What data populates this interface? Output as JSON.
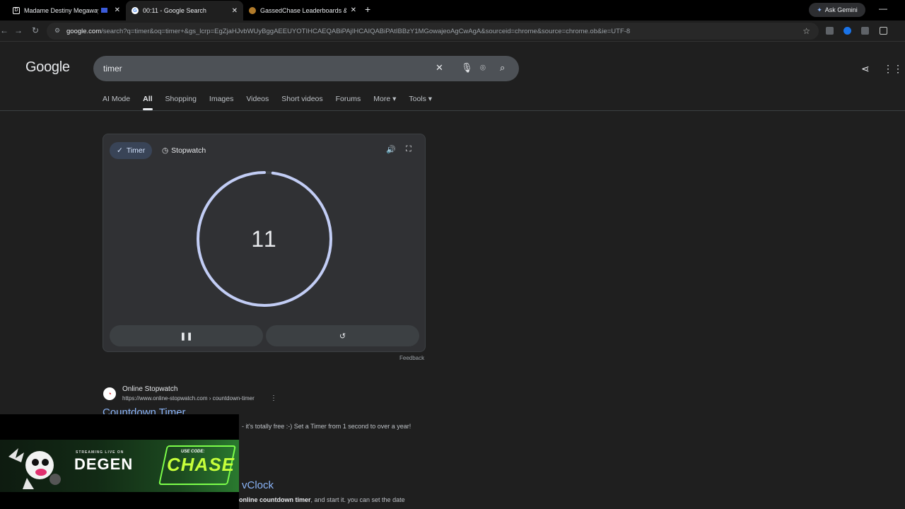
{
  "browser": {
    "tabs": [
      {
        "title": "Madame Destiny Megaways",
        "active": false
      },
      {
        "title": "00:11 - Google Search",
        "active": true
      },
      {
        "title": "GassedChase Leaderboards & B",
        "active": false
      }
    ],
    "new_tab": "+",
    "ask_gemini": "Ask Gemini",
    "url_host": "google.com",
    "url_rest": "/search?q=timer&oq=timer+&gs_lcrp=EgZjaHJvbWUyBggAEEUYOTIHCAEQABiPAjIHCAIQABiPAtIBBzY1MGowajeoAgCwAgA&sourceid=chrome&source=chrome.ob&ie=UTF-8",
    "close_glyph": "✕"
  },
  "google": {
    "logo": "Google",
    "query": "timer",
    "nav_tabs": [
      "AI Mode",
      "All",
      "Shopping",
      "Images",
      "Videos",
      "Short videos",
      "Forums",
      "More ▾",
      "Tools ▾"
    ],
    "active_tab": "All"
  },
  "timer_card": {
    "timer_label": "Timer",
    "stopwatch_label": "Stopwatch",
    "value": "11",
    "progress": 0.98,
    "accent": "#c2cdf5",
    "feedback": "Feedback"
  },
  "results": [
    {
      "site": "Online Stopwatch",
      "url": "https://www.online-stopwatch.com › countdown-timer",
      "title": "Countdown Timer",
      "snippet": "- it's totally free :-) Set a Timer from 1 second to over a year!"
    },
    {
      "title": "vClock",
      "snippet_bold": "online countdown timer",
      "snippet_rest": ", and start it. you can set the date"
    }
  ],
  "overlay": {
    "streaming": "STREAMING LIVE ON",
    "brand": "DEGEN",
    "use_code": "USE CODE:",
    "code": "CHASE"
  }
}
